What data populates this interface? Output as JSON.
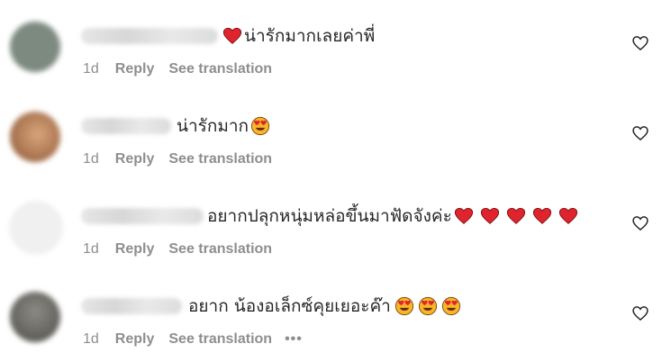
{
  "comments": [
    {
      "text": "น่ารักมากเลยค่าพี่",
      "lead_heart": true,
      "hearts": 0,
      "faces": 0,
      "age": "1d",
      "reply": "Reply",
      "translate": "See translation",
      "more": "",
      "avatar_color": "#7d8a80",
      "like_icon": "heart-outline-icon"
    },
    {
      "text": "น่ารักมาก",
      "lead_heart": false,
      "hearts": 0,
      "faces": 1,
      "age": "1d",
      "reply": "Reply",
      "translate": "See translation",
      "more": "",
      "avatar_color": "#b47c54",
      "like_icon": "heart-outline-icon"
    },
    {
      "text": "อยากปลุกหนุ่มหล่อขึ้นมาฟัดจังค่ะ",
      "lead_heart": false,
      "hearts": 5,
      "faces": 0,
      "age": "1d",
      "reply": "Reply",
      "translate": "See translation",
      "more": "",
      "avatar_color": "#efefef",
      "like_icon": "heart-outline-icon"
    },
    {
      "text": "อยาก น้องอเล็กซ์คุยเยอะค๊า",
      "lead_heart": false,
      "hearts": 0,
      "faces": 3,
      "age": "1d",
      "reply": "Reply",
      "translate": "See translation",
      "more": "•••",
      "avatar_color": "#6e6c66",
      "like_icon": "heart-outline-icon"
    }
  ],
  "colors": {
    "heart_red": "#e0242e",
    "muted": "#8e8e8e",
    "text": "#262626"
  }
}
